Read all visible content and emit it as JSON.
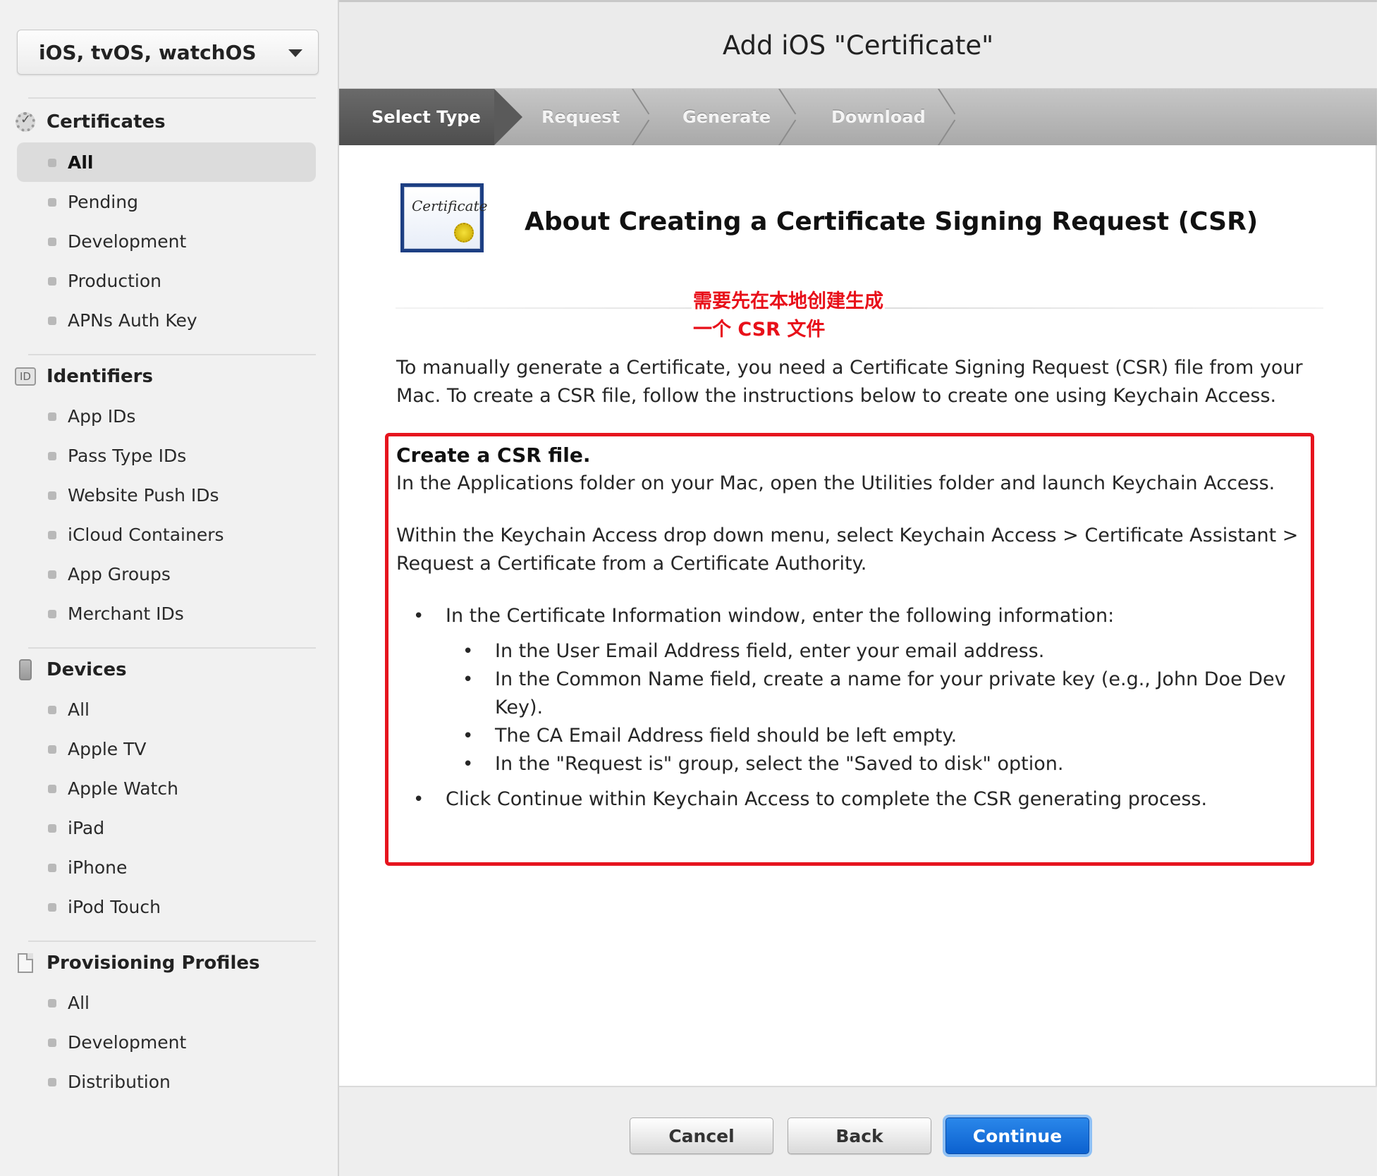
{
  "sidebar": {
    "platform": "iOS, tvOS, watchOS",
    "sections": [
      {
        "title": "Certificates",
        "icon": "certificate-icon",
        "items": [
          "All",
          "Pending",
          "Development",
          "Production",
          "APNs Auth Key"
        ]
      },
      {
        "title": "Identifiers",
        "icon": "id-icon",
        "icon_text": "ID",
        "items": [
          "App IDs",
          "Pass Type IDs",
          "Website Push IDs",
          "iCloud Containers",
          "App Groups",
          "Merchant IDs"
        ]
      },
      {
        "title": "Devices",
        "icon": "device-icon",
        "items": [
          "All",
          "Apple TV",
          "Apple Watch",
          "iPad",
          "iPhone",
          "iPod Touch"
        ]
      },
      {
        "title": "Provisioning Profiles",
        "icon": "document-icon",
        "items": [
          "All",
          "Development",
          "Distribution"
        ]
      }
    ],
    "active_item": "Certificates / All"
  },
  "main": {
    "window_title": "Add iOS \"Certificate\"",
    "steps": [
      "Select Type",
      "Request",
      "Generate",
      "Download"
    ],
    "active_step": "Select Type",
    "heading": "About Creating a Certificate Signing Request (CSR)",
    "cert_image_text": "Certificate",
    "annotation": {
      "line1": "需要先在本地创建生成",
      "line2": "一个 CSR 文件",
      "color": "#e8101a"
    },
    "intro": "To manually generate a Certificate, you need a Certificate Signing Request (CSR) file from your Mac. To create a CSR file, follow the instructions below to create one using Keychain Access.",
    "instructions": {
      "heading": "Create a CSR file.",
      "p1": "In the Applications folder on your Mac, open the Utilities folder and launch Keychain Access.",
      "p2": "Within the Keychain Access drop down menu, select Keychain Access > Certificate Assistant > Request a Certificate from a Certificate Authority.",
      "bullet1": "In the Certificate Information window, enter the following information:",
      "sub_bullets": [
        "In the User Email Address field, enter your email address.",
        "In the Common Name field, create a name for your private key (e.g., John Doe Dev Key).",
        "The CA Email Address field should be left empty.",
        "In the \"Request is\" group, select the \"Saved to disk\" option."
      ],
      "bullet2": "Click Continue within Keychain Access to complete the CSR generating process."
    },
    "highlight_color": "#e6141e"
  },
  "footer": {
    "cancel": "Cancel",
    "back": "Back",
    "continue": "Continue",
    "primary_color": "#0c61cf"
  }
}
